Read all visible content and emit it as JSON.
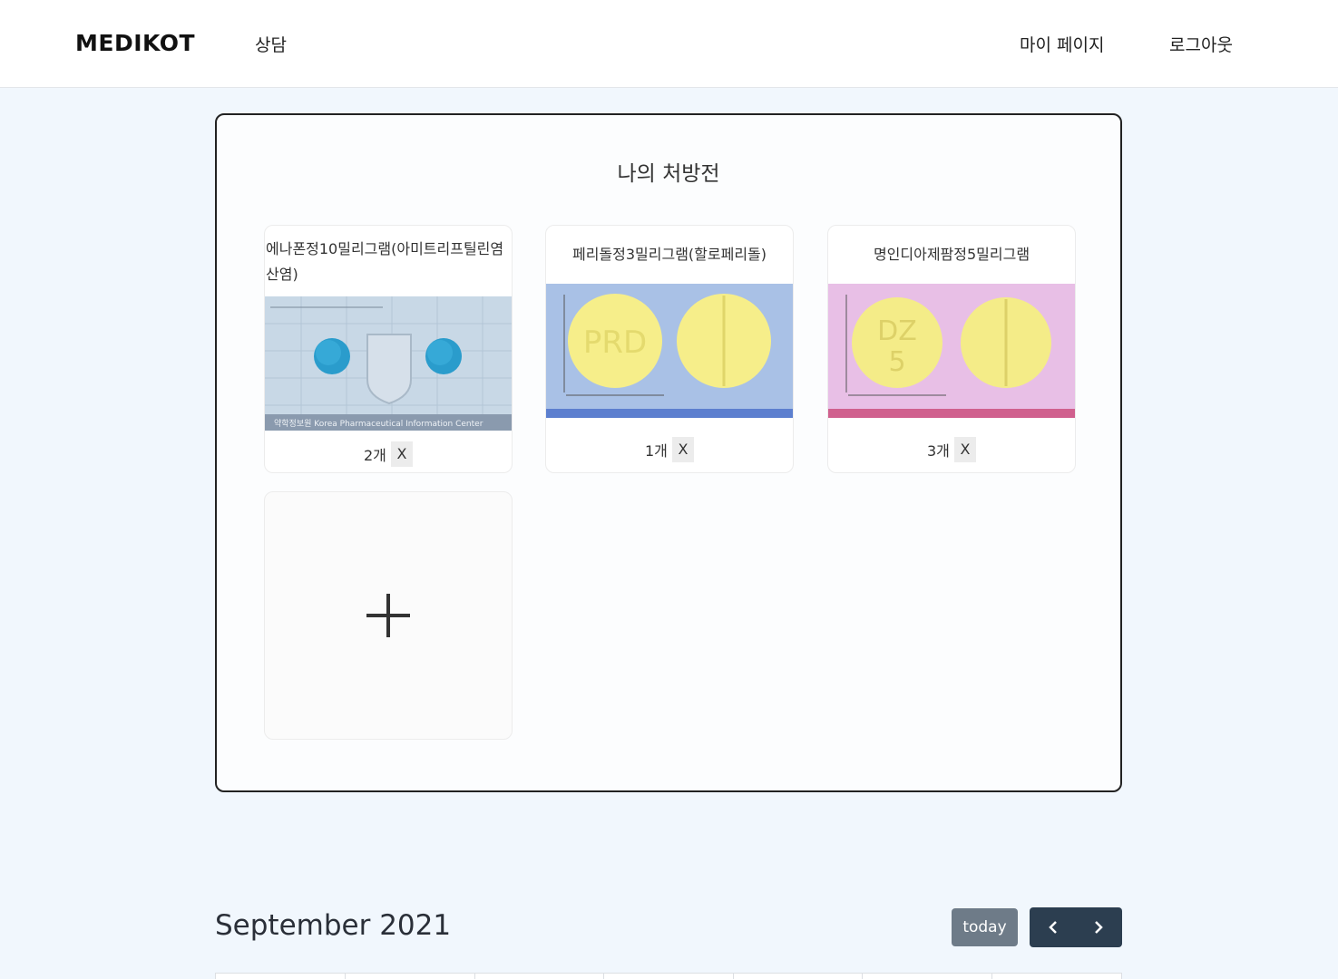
{
  "header": {
    "logo": "MEDIKOT",
    "nav_consult": "상담",
    "nav_mypage": "마이 페이지",
    "nav_logout": "로그아웃"
  },
  "prescription": {
    "title": "나의 처방전",
    "cards": [
      {
        "name": "에나폰정10밀리그램(아미트리프틸린염산염)",
        "count": "2개",
        "remove": "X",
        "image_label": "약학정보원  Korea Pharmaceutical Information Center"
      },
      {
        "name": "페리돌정3밀리그램(할로페리돌)",
        "count": "1개",
        "remove": "X",
        "image_label": "PRD"
      },
      {
        "name": "명인디아제팜정5밀리그램",
        "count": "3개",
        "remove": "X",
        "image_label": "DZ 5"
      }
    ],
    "add_icon": "plus-icon"
  },
  "calendar": {
    "title": "September 2021",
    "today_label": "today",
    "prev_icon": "chevron-left-icon",
    "next_icon": "chevron-right-icon"
  },
  "colors": {
    "page_bg": "#f1f7fd",
    "nav_dark": "#2c3e50",
    "today_btn": "#6e7b88",
    "pill_blue": "#2fa6cf",
    "pill_yellow": "#f6ee8a"
  }
}
